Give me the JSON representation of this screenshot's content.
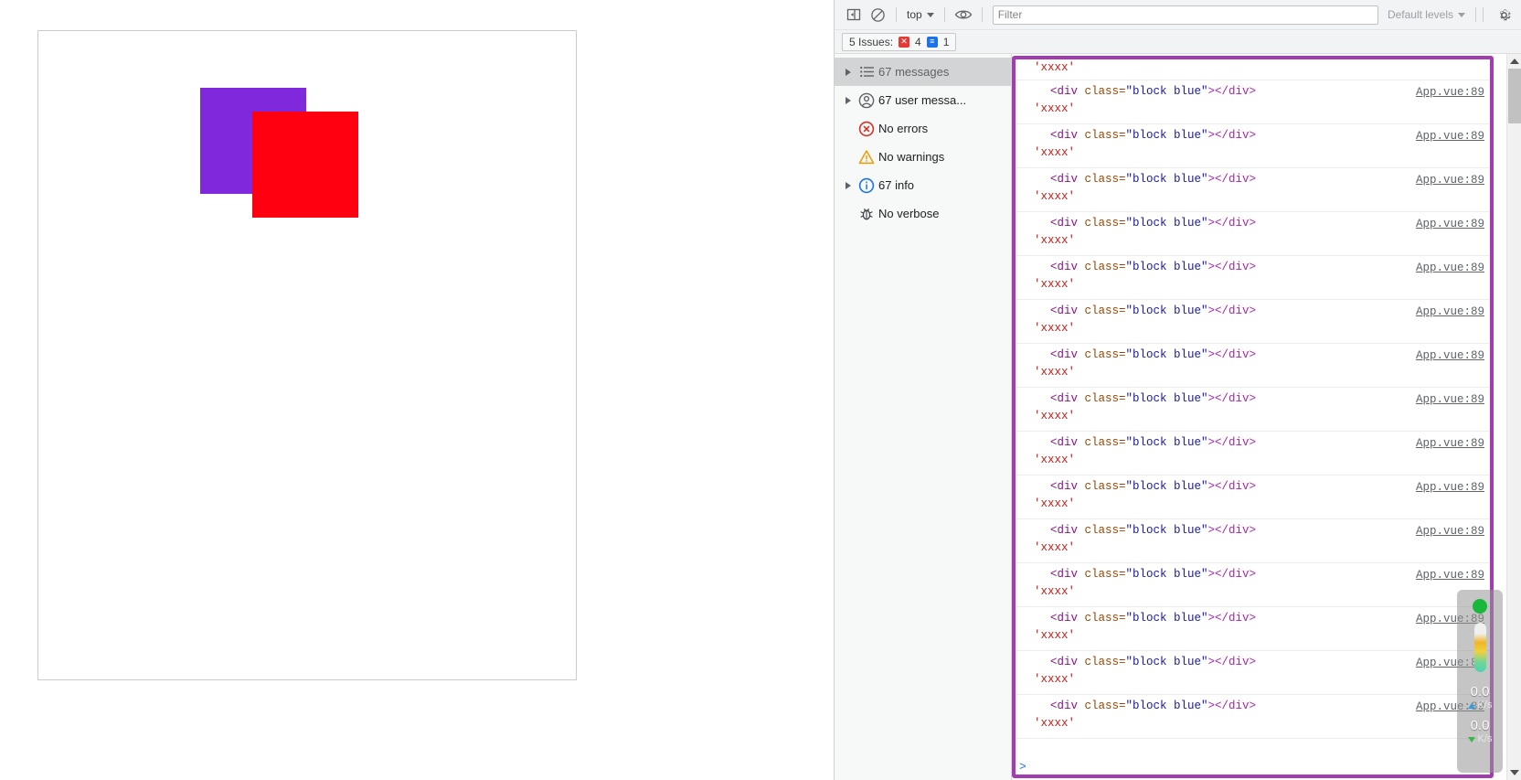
{
  "page": {
    "frame_border_color": "#c9cccf",
    "blocks": [
      {
        "name": "block-purple",
        "class": "block purple",
        "color": "#7F28DC"
      },
      {
        "name": "block-red",
        "class": "block red",
        "color": "#FF0011"
      }
    ]
  },
  "devtools": {
    "toolbar": {
      "sidebar_toggle_title": "Show console sidebar",
      "clear_console_title": "Clear console",
      "context": "top",
      "eye_title": "Create live expression",
      "filter_placeholder": "Filter",
      "filter_value": "",
      "levels": "Default levels",
      "settings_title": "Console settings"
    },
    "issues": {
      "label": "5 Issues:",
      "error_count": "4",
      "info_count": "1",
      "error_color": "#e53935",
      "info_color": "#1a73e8"
    },
    "sidebar": {
      "items": [
        {
          "label": "67 messages",
          "icon": "list-icon",
          "expandable": true,
          "selected": true
        },
        {
          "label": "67 user messa...",
          "icon": "user-icon",
          "expandable": true,
          "selected": false
        },
        {
          "label": "No errors",
          "icon": "error-icon",
          "expandable": false,
          "selected": false
        },
        {
          "label": "No warnings",
          "icon": "warning-icon",
          "expandable": false,
          "selected": false
        },
        {
          "label": "67 info",
          "icon": "info-icon",
          "expandable": true,
          "selected": false
        },
        {
          "label": "No verbose",
          "icon": "bug-icon",
          "expandable": false,
          "selected": false
        }
      ]
    },
    "console": {
      "focus_ring_color": "#a33cb0",
      "prompt": ">",
      "partial_top_line": "'xxxx'",
      "messages": [
        {
          "tag_open": "<div",
          "attr": " class=",
          "value": "\"block blue\"",
          "tag_close": "></div>",
          "source": "App.vue:89",
          "sub": "'xxxx'"
        },
        {
          "tag_open": "<div",
          "attr": " class=",
          "value": "\"block blue\"",
          "tag_close": "></div>",
          "source": "App.vue:89",
          "sub": "'xxxx'"
        },
        {
          "tag_open": "<div",
          "attr": " class=",
          "value": "\"block blue\"",
          "tag_close": "></div>",
          "source": "App.vue:89",
          "sub": "'xxxx'"
        },
        {
          "tag_open": "<div",
          "attr": " class=",
          "value": "\"block blue\"",
          "tag_close": "></div>",
          "source": "App.vue:89",
          "sub": "'xxxx'"
        },
        {
          "tag_open": "<div",
          "attr": " class=",
          "value": "\"block blue\"",
          "tag_close": "></div>",
          "source": "App.vue:89",
          "sub": "'xxxx'"
        },
        {
          "tag_open": "<div",
          "attr": " class=",
          "value": "\"block blue\"",
          "tag_close": "></div>",
          "source": "App.vue:89",
          "sub": "'xxxx'"
        },
        {
          "tag_open": "<div",
          "attr": " class=",
          "value": "\"block blue\"",
          "tag_close": "></div>",
          "source": "App.vue:89",
          "sub": "'xxxx'"
        },
        {
          "tag_open": "<div",
          "attr": " class=",
          "value": "\"block blue\"",
          "tag_close": "></div>",
          "source": "App.vue:89",
          "sub": "'xxxx'"
        },
        {
          "tag_open": "<div",
          "attr": " class=",
          "value": "\"block blue\"",
          "tag_close": "></div>",
          "source": "App.vue:89",
          "sub": "'xxxx'"
        },
        {
          "tag_open": "<div",
          "attr": " class=",
          "value": "\"block blue\"",
          "tag_close": "></div>",
          "source": "App.vue:89",
          "sub": "'xxxx'"
        },
        {
          "tag_open": "<div",
          "attr": " class=",
          "value": "\"block blue\"",
          "tag_close": "></div>",
          "source": "App.vue:89",
          "sub": "'xxxx'"
        },
        {
          "tag_open": "<div",
          "attr": " class=",
          "value": "\"block blue\"",
          "tag_close": "></div>",
          "source": "App.vue:89",
          "sub": "'xxxx'"
        },
        {
          "tag_open": "<div",
          "attr": " class=",
          "value": "\"block blue\"",
          "tag_close": "></div>",
          "source": "App.vue:89",
          "sub": "'xxxx'"
        },
        {
          "tag_open": "<div",
          "attr": " class=",
          "value": "\"block blue\"",
          "tag_close": "></div>",
          "source": "App.vue:89",
          "sub": "'xxxx'"
        },
        {
          "tag_open": "<div",
          "attr": " class=",
          "value": "\"block blue\"",
          "tag_close": "></div>",
          "source": "App.vue:89",
          "sub": "'xxxx'"
        }
      ]
    }
  },
  "netspeed": {
    "status_color": "#18b83a",
    "upload_value": "0.0",
    "upload_unit": "K/s",
    "download_value": "0.0",
    "download_unit": "K/s"
  }
}
